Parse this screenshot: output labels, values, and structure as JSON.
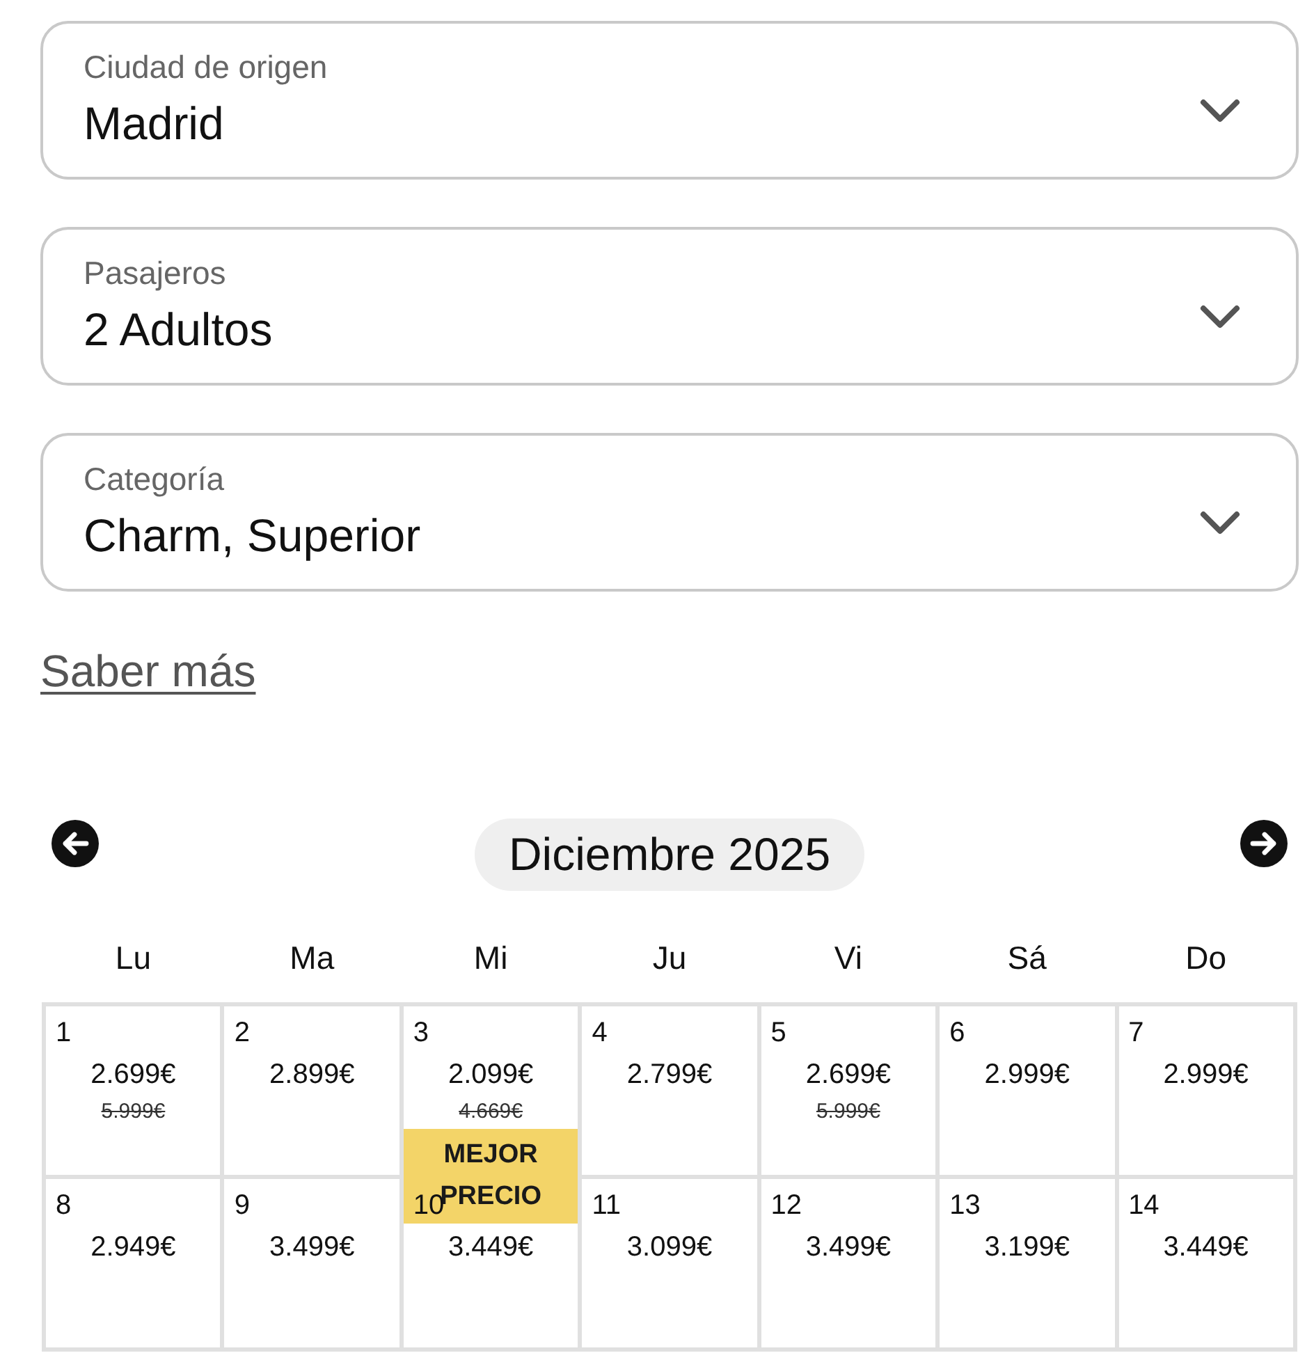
{
  "fields": [
    {
      "label": "Ciudad de origen",
      "value": "Madrid"
    },
    {
      "label": "Pasajeros",
      "value": "2 Adultos"
    },
    {
      "label": "Categoría",
      "value": "Charm, Superior"
    }
  ],
  "link": {
    "label": "Saber más"
  },
  "calendar": {
    "month": "Diciembre 2025",
    "weekdays": [
      "Lu",
      "Ma",
      "Mi",
      "Ju",
      "Vi",
      "Sá",
      "Do"
    ],
    "weeks": [
      [
        {
          "day": "1",
          "price": "2.699€",
          "old_price": "5.999€"
        },
        {
          "day": "2",
          "price": "2.899€"
        },
        {
          "day": "3",
          "price": "2.099€",
          "old_price": "4.669€",
          "badge": "MEJOR PRECIO"
        },
        {
          "day": "4",
          "price": "2.799€"
        },
        {
          "day": "5",
          "price": "2.699€",
          "old_price": "5.999€"
        },
        {
          "day": "6",
          "price": "2.999€"
        },
        {
          "day": "7",
          "price": "2.999€"
        }
      ],
      [
        {
          "day": "8",
          "price": "2.949€"
        },
        {
          "day": "9",
          "price": "3.499€"
        },
        {
          "day": "10",
          "price": "3.449€"
        },
        {
          "day": "11",
          "price": "3.099€"
        },
        {
          "day": "12",
          "price": "3.499€"
        },
        {
          "day": "13",
          "price": "3.199€"
        },
        {
          "day": "14",
          "price": "3.449€"
        }
      ]
    ]
  }
}
